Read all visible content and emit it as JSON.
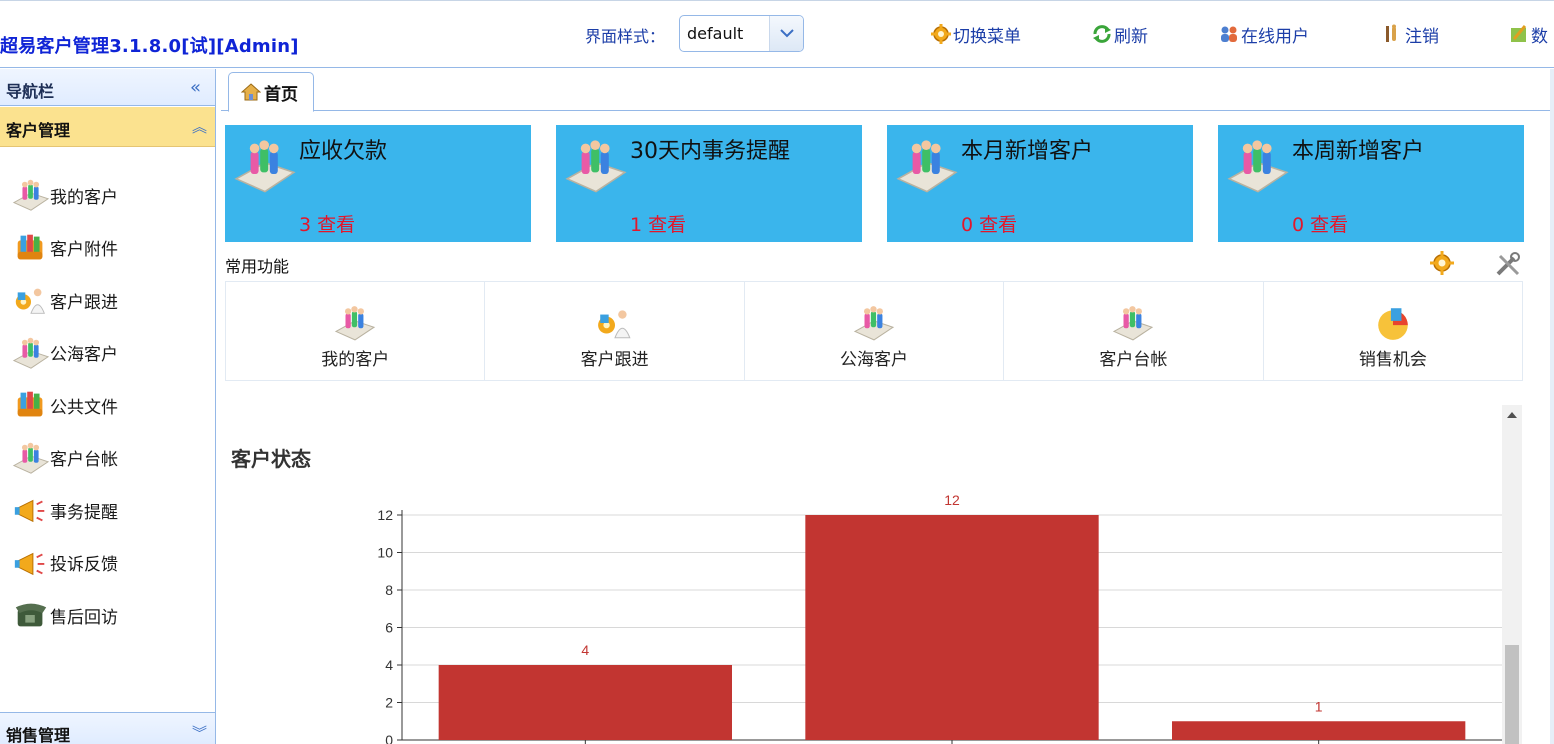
{
  "header": {
    "app_title": "超易客户管理3.1.8.0[试][Admin]",
    "style_label": "界面样式：",
    "style_value": "default",
    "tools": [
      {
        "label": "切换菜单",
        "icon": "gear-icon"
      },
      {
        "label": "刷新",
        "icon": "refresh-icon"
      },
      {
        "label": "在线用户",
        "icon": "online-users-icon"
      },
      {
        "label": "注销",
        "icon": "logout-icon"
      },
      {
        "label": "数",
        "icon": "data-icon"
      }
    ]
  },
  "nav": {
    "title": "导航栏",
    "collapse_glyph": "«",
    "active_group": {
      "label": "客户管理",
      "glyph": "︽"
    },
    "items": [
      {
        "label": "我的客户",
        "icon": "people-icon"
      },
      {
        "label": "客户附件",
        "icon": "books-icon"
      },
      {
        "label": "客户跟进",
        "icon": "followup-icon"
      },
      {
        "label": "公海客户",
        "icon": "people-icon"
      },
      {
        "label": "公共文件",
        "icon": "books-icon"
      },
      {
        "label": "客户台帐",
        "icon": "people-icon"
      },
      {
        "label": "事务提醒",
        "icon": "megaphone-icon"
      },
      {
        "label": "投诉反馈",
        "icon": "megaphone-icon"
      },
      {
        "label": "售后回访",
        "icon": "phone-icon"
      }
    ],
    "bottom_group": {
      "label": "销售管理",
      "glyph": "︾"
    }
  },
  "tabs": [
    {
      "label": "首页",
      "icon": "home-icon"
    }
  ],
  "cards": [
    {
      "title": "应收欠款",
      "count": "3",
      "link": "查看"
    },
    {
      "title": "30天内事务提醒",
      "count": "1",
      "link": "查看"
    },
    {
      "title": "本月新增客户",
      "count": "0",
      "link": "查看"
    },
    {
      "title": "本周新增客户",
      "count": "0",
      "link": "查看"
    }
  ],
  "common": {
    "label": "常用功能",
    "items": [
      {
        "label": "我的客户",
        "icon": "people-icon"
      },
      {
        "label": "客户跟进",
        "icon": "followup-icon"
      },
      {
        "label": "公海客户",
        "icon": "people-icon"
      },
      {
        "label": "客户台帐",
        "icon": "people-icon"
      },
      {
        "label": "销售机会",
        "icon": "opportunity-icon"
      }
    ]
  },
  "chart_title": "客户状态",
  "chart_data": {
    "type": "bar",
    "title": "客户状态",
    "categories": [
      "",
      "",
      ""
    ],
    "values": [
      4,
      12,
      1
    ],
    "ylim": [
      0,
      12
    ],
    "yticks": [
      0,
      2,
      4,
      6,
      8,
      10,
      12
    ],
    "grid": true,
    "bar_color": "#c23531",
    "label_color": "#c23531"
  },
  "colors": {
    "card_bg": "#3ab5ec",
    "accent_red": "#e4162a",
    "title_blue": "#0f24d6",
    "active_group": "#fbe28f"
  }
}
